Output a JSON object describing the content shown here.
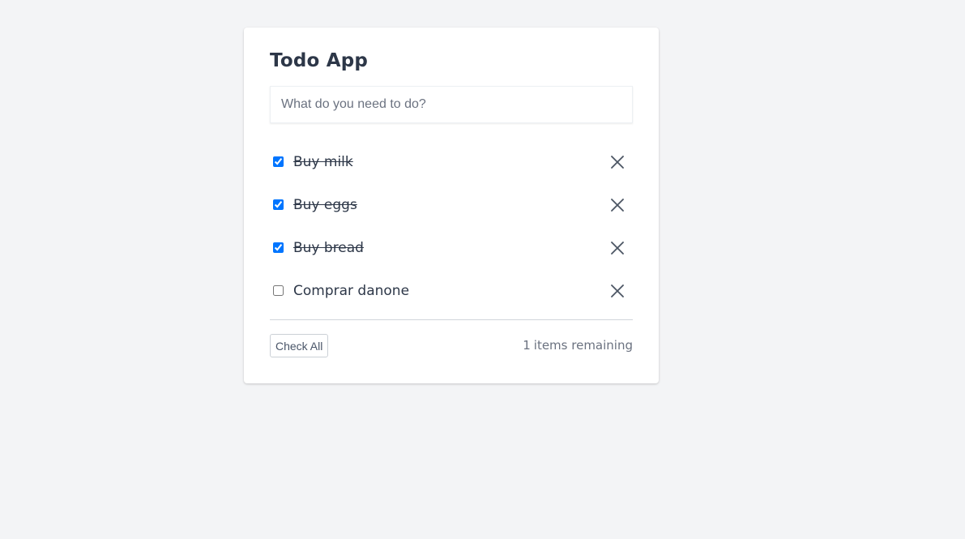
{
  "app": {
    "title": "Todo App"
  },
  "new_todo": {
    "placeholder": "What do you need to do?",
    "value": ""
  },
  "todos": [
    {
      "label": "Buy milk",
      "completed": true
    },
    {
      "label": "Buy eggs",
      "completed": true
    },
    {
      "label": "Buy bread",
      "completed": true
    },
    {
      "label": "Comprar danone",
      "completed": false
    }
  ],
  "footer": {
    "check_all_label": "Check All",
    "remaining_count": "1",
    "remaining_suffix": "items remaining"
  },
  "colors": {
    "background": "#f3f4f6",
    "card": "#ffffff",
    "text": "#2d3748",
    "muted": "#6b7280",
    "checkbox_accent": "#0075ff"
  },
  "icons": {
    "remove": "close-icon"
  }
}
